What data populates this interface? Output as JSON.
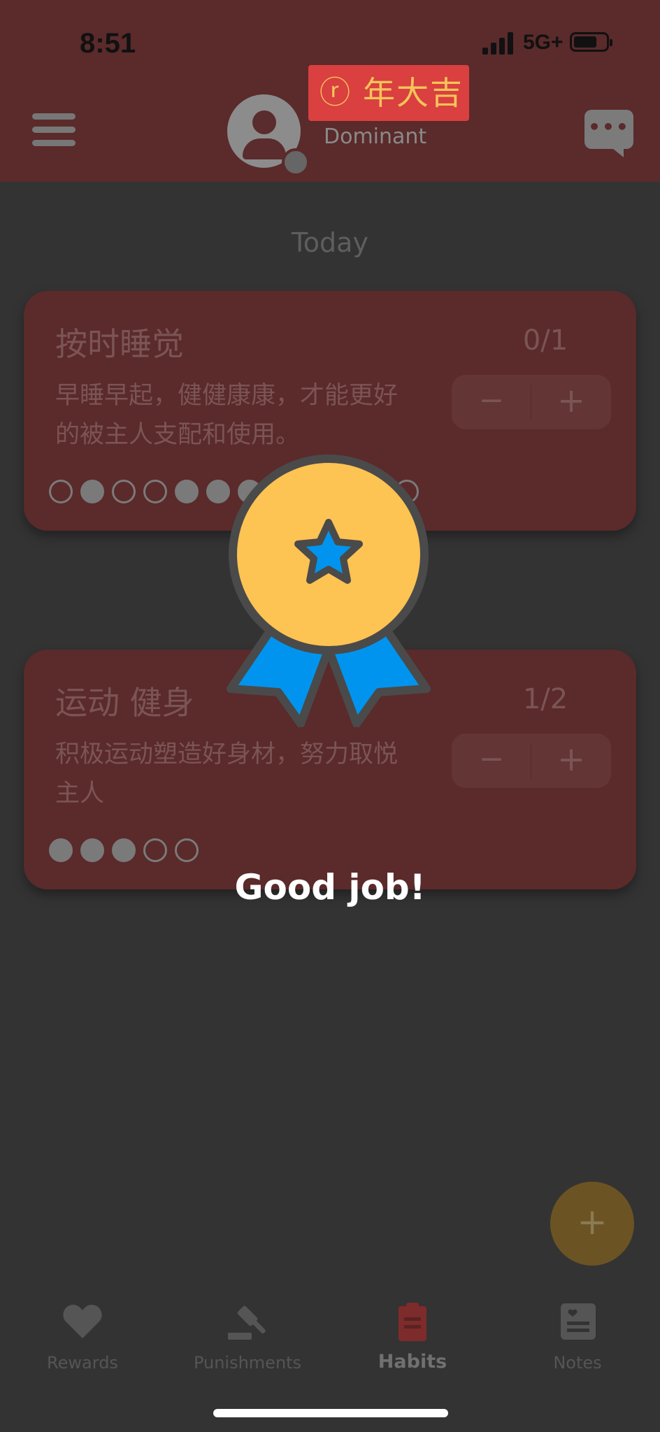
{
  "status_bar": {
    "time": "8:51",
    "network": "5G+"
  },
  "header": {
    "role": "Dominant",
    "banner": {
      "text": "年大吉"
    }
  },
  "today_label": "Today",
  "habits": [
    {
      "title": "按时睡觉",
      "description": "早睡早起，健健康康，才能更好的被主人支配和使用。",
      "count": "0/1",
      "dots": [
        0,
        1,
        0,
        0,
        1,
        1,
        1,
        0,
        0,
        0,
        0,
        0
      ]
    },
    {
      "title": "运动 健身",
      "description": "积极运动塑造好身材，努力取悦主人",
      "count": "1/2",
      "dots": [
        1,
        1,
        1,
        0,
        0
      ]
    }
  ],
  "stepper": {
    "minus": "−",
    "plus": "+"
  },
  "overlay": {
    "message": "Good job!"
  },
  "fab_label": "+",
  "tabs": [
    {
      "label": "Rewards",
      "icon": "heart-icon"
    },
    {
      "label": "Punishments",
      "icon": "gavel-icon"
    },
    {
      "label": "Habits",
      "icon": "clipboard-icon",
      "active": true
    },
    {
      "label": "Notes",
      "icon": "notes-icon"
    }
  ],
  "colors": {
    "header": "#5b2a2b",
    "background": "#333333",
    "medal_gold": "#fdc353",
    "ribbon_blue": "#0194ef",
    "active_tab_icon": "#7e2b2b"
  }
}
